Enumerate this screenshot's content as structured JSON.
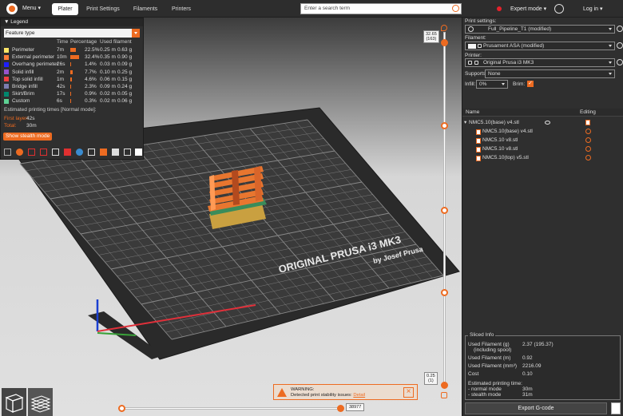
{
  "topbar": {
    "menu": "Menu",
    "tabs": [
      "Plater",
      "Print Settings",
      "Filaments",
      "Printers"
    ],
    "active_tab": "Plater",
    "search_placeholder": "Enter a search term",
    "mode": "Expert mode",
    "mode_color": "#e5212b",
    "login": "Log in"
  },
  "legend": {
    "header": "Legend",
    "view_type": "Feature type",
    "columns": {
      "time": "Time",
      "percentage": "Percentage",
      "used": "Used filament"
    },
    "rows": [
      {
        "name": "Perimeter",
        "color": "#ffe667",
        "time": "7m",
        "pct": "22.5%",
        "pct_value": 22.5,
        "len": "0.25 m",
        "weight": "0.63 g"
      },
      {
        "name": "External perimeter",
        "color": "#ff7d38",
        "time": "10m",
        "pct": "32.4%",
        "pct_value": 32.4,
        "len": "0.35 m",
        "weight": "0.90 g"
      },
      {
        "name": "Overhang perimeter",
        "color": "#1f1fff",
        "time": "26s",
        "pct": "1.4%",
        "pct_value": 1.4,
        "len": "0.03 m",
        "weight": "0.09 g"
      },
      {
        "name": "Solid infill",
        "color": "#9654cc",
        "time": "2m",
        "pct": "7.7%",
        "pct_value": 7.7,
        "len": "0.10 m",
        "weight": "0.25 g"
      },
      {
        "name": "Top solid infill",
        "color": "#f04040",
        "time": "1m",
        "pct": "4.6%",
        "pct_value": 4.6,
        "len": "0.06 m",
        "weight": "0.15 g"
      },
      {
        "name": "Bridge infill",
        "color": "#7d7db0",
        "time": "42s",
        "pct": "2.3%",
        "pct_value": 2.3,
        "len": "0.09 m",
        "weight": "0.24 g"
      },
      {
        "name": "Skirt/Brim",
        "color": "#00876e",
        "time": "17s",
        "pct": "0.9%",
        "pct_value": 0.9,
        "len": "0.02 m",
        "weight": "0.05 g"
      },
      {
        "name": "Custom",
        "color": "#5ed194",
        "time": "6s",
        "pct": "0.3%",
        "pct_value": 0.3,
        "len": "0.02 m",
        "weight": "0.06 g"
      }
    ],
    "est_title": "Estimated printing times [Normal mode]:",
    "first_layer_label": "First layer:",
    "first_layer": "42s",
    "total_label": "Total:",
    "total": "30m",
    "stealth_button": "Show stealth mode"
  },
  "slider": {
    "top_value": "32.65",
    "top_layer": "(163)",
    "bottom_value": "0.25",
    "bottom_layer": "(1)",
    "horizontal_value": "38977"
  },
  "warning": {
    "title": "WARNING:",
    "message": "Detected print stability issues:",
    "link": "Detail"
  },
  "right": {
    "print_settings_label": "Print settings:",
    "print_settings": "Full_Pipeline_T1 (modified)",
    "filament_label": "Filament:",
    "filament": "Prusament ASA (modified)",
    "printer_label": "Printer:",
    "printer": "Original Prusa i3 MK3",
    "supports_label": "Supports:",
    "supports": "None",
    "infill_label": "Infill:",
    "infill": "0%",
    "brim_label": "Brim:",
    "col_name": "Name",
    "col_editing": "Editing",
    "objects": [
      {
        "name": "NMC5.10(base) v4.stl",
        "level": 0
      },
      {
        "name": "NMC5.10(base) v4.stl",
        "level": 1
      },
      {
        "name": "NMC5.10 v8.stl",
        "level": 1
      },
      {
        "name": "NMC5.10 v8.stl",
        "level": 1
      },
      {
        "name": "NMC5.10(top) v5.stl",
        "level": 1
      }
    ],
    "sliced": {
      "title": "Sliced Info",
      "rows": [
        {
          "label": "Used Filament (g)",
          "sub": "(including spool)",
          "value": "2.37 (195.37)"
        },
        {
          "label": "Used Filament (m)",
          "value": "0.92"
        },
        {
          "label": "Used Filament (mm³)",
          "value": "2216.09"
        },
        {
          "label": "Cost",
          "value": "0.10"
        }
      ],
      "est_label": "Estimated printing time:",
      "normal_label": "- normal mode",
      "normal": "30m",
      "stealth_label": "- stealth mode",
      "stealth": "31m"
    },
    "export": "Export G-code"
  },
  "bed_text": {
    "line1": "ORIGINAL PRUSA i3 MK3",
    "line2": "by Josef Prusa"
  },
  "accent": "#ed6b21"
}
